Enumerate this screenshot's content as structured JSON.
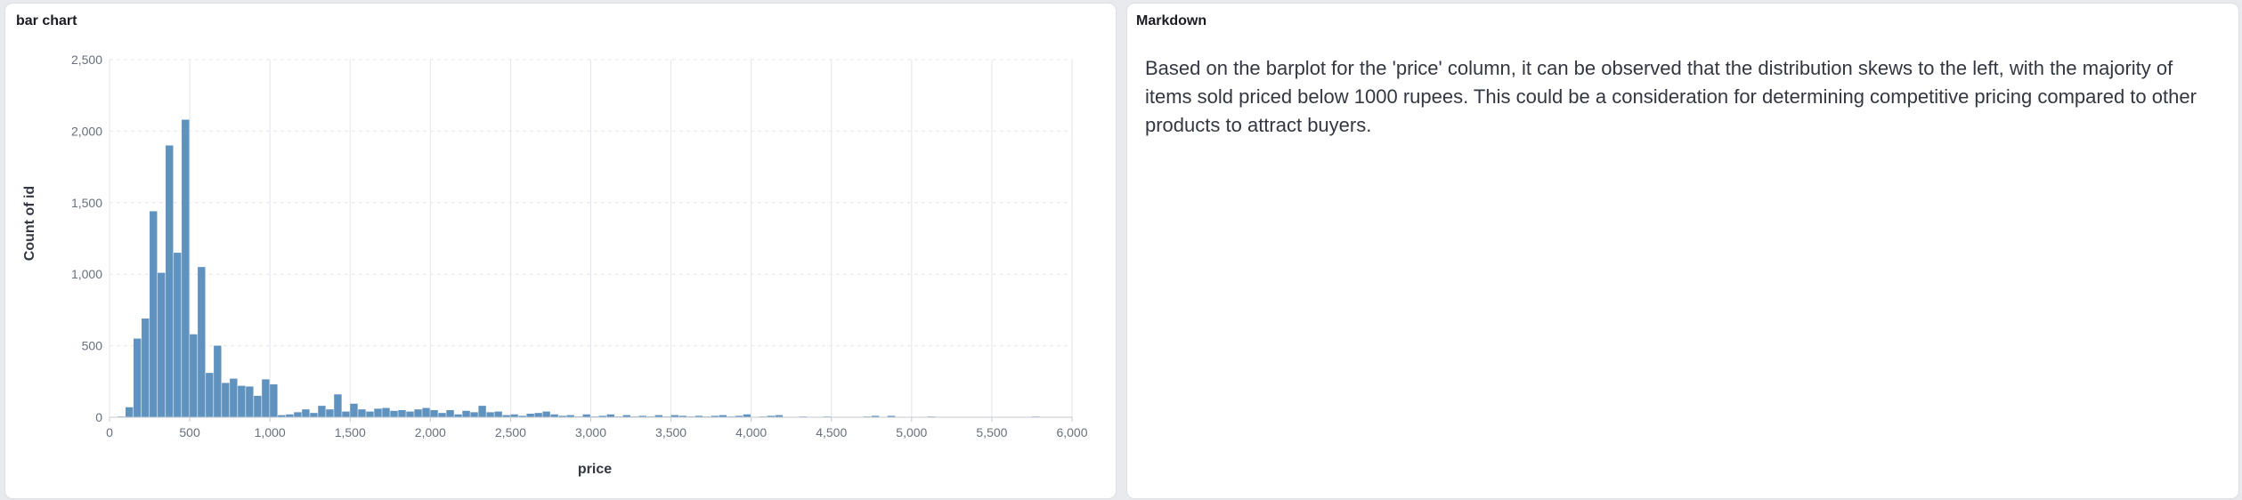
{
  "chart_panel": {
    "title": "bar chart"
  },
  "markdown_panel": {
    "title": "Markdown",
    "text": "Based on the barplot for the 'price' column, it can be observed that the distribution skews to the left, with the majority of items sold priced below 1000 rupees. This could be a consideration for determining competitive pricing compared to other products to attract buyers."
  },
  "colors": {
    "bar": "#6092c0",
    "grid": "#e3e6ea",
    "axis": "#c5c9d1"
  },
  "chart_data": {
    "type": "bar",
    "title": "",
    "xlabel": "price",
    "ylabel": "Count of id",
    "xlim": [
      0,
      6000
    ],
    "ylim": [
      0,
      2500
    ],
    "x_ticks": [
      "0",
      "500",
      "1,000",
      "1,500",
      "2,000",
      "2,500",
      "3,000",
      "3,500",
      "4,000",
      "4,500",
      "5,000",
      "5,500",
      "6,000"
    ],
    "y_ticks": [
      "0",
      "500",
      "1,000",
      "1,500",
      "2,000",
      "2,500"
    ],
    "grid": true,
    "bin_width": 50,
    "bins": [
      {
        "x": 50,
        "count": 5
      },
      {
        "x": 100,
        "count": 70
      },
      {
        "x": 150,
        "count": 550
      },
      {
        "x": 200,
        "count": 690
      },
      {
        "x": 250,
        "count": 1440
      },
      {
        "x": 300,
        "count": 1010
      },
      {
        "x": 350,
        "count": 1900
      },
      {
        "x": 400,
        "count": 1150
      },
      {
        "x": 450,
        "count": 2080
      },
      {
        "x": 500,
        "count": 580
      },
      {
        "x": 550,
        "count": 1050
      },
      {
        "x": 600,
        "count": 310
      },
      {
        "x": 650,
        "count": 500
      },
      {
        "x": 700,
        "count": 240
      },
      {
        "x": 750,
        "count": 270
      },
      {
        "x": 800,
        "count": 220
      },
      {
        "x": 850,
        "count": 215
      },
      {
        "x": 900,
        "count": 150
      },
      {
        "x": 950,
        "count": 265
      },
      {
        "x": 1000,
        "count": 230
      },
      {
        "x": 1050,
        "count": 15
      },
      {
        "x": 1100,
        "count": 20
      },
      {
        "x": 1150,
        "count": 35
      },
      {
        "x": 1200,
        "count": 55
      },
      {
        "x": 1250,
        "count": 30
      },
      {
        "x": 1300,
        "count": 80
      },
      {
        "x": 1350,
        "count": 55
      },
      {
        "x": 1400,
        "count": 160
      },
      {
        "x": 1450,
        "count": 40
      },
      {
        "x": 1500,
        "count": 95
      },
      {
        "x": 1550,
        "count": 55
      },
      {
        "x": 1600,
        "count": 40
      },
      {
        "x": 1650,
        "count": 60
      },
      {
        "x": 1700,
        "count": 65
      },
      {
        "x": 1750,
        "count": 45
      },
      {
        "x": 1800,
        "count": 50
      },
      {
        "x": 1850,
        "count": 40
      },
      {
        "x": 1900,
        "count": 55
      },
      {
        "x": 1950,
        "count": 65
      },
      {
        "x": 2000,
        "count": 50
      },
      {
        "x": 2050,
        "count": 30
      },
      {
        "x": 2100,
        "count": 50
      },
      {
        "x": 2150,
        "count": 20
      },
      {
        "x": 2200,
        "count": 45
      },
      {
        "x": 2250,
        "count": 35
      },
      {
        "x": 2300,
        "count": 80
      },
      {
        "x": 2350,
        "count": 35
      },
      {
        "x": 2400,
        "count": 40
      },
      {
        "x": 2450,
        "count": 15
      },
      {
        "x": 2500,
        "count": 20
      },
      {
        "x": 2550,
        "count": 10
      },
      {
        "x": 2600,
        "count": 25
      },
      {
        "x": 2650,
        "count": 30
      },
      {
        "x": 2700,
        "count": 40
      },
      {
        "x": 2750,
        "count": 20
      },
      {
        "x": 2800,
        "count": 10
      },
      {
        "x": 2850,
        "count": 15
      },
      {
        "x": 2900,
        "count": 5
      },
      {
        "x": 2950,
        "count": 20
      },
      {
        "x": 3000,
        "count": 5
      },
      {
        "x": 3050,
        "count": 10
      },
      {
        "x": 3100,
        "count": 20
      },
      {
        "x": 3150,
        "count": 5
      },
      {
        "x": 3200,
        "count": 15
      },
      {
        "x": 3250,
        "count": 5
      },
      {
        "x": 3300,
        "count": 10
      },
      {
        "x": 3350,
        "count": 5
      },
      {
        "x": 3400,
        "count": 15
      },
      {
        "x": 3450,
        "count": 5
      },
      {
        "x": 3500,
        "count": 15
      },
      {
        "x": 3550,
        "count": 10
      },
      {
        "x": 3600,
        "count": 5
      },
      {
        "x": 3650,
        "count": 10
      },
      {
        "x": 3700,
        "count": 5
      },
      {
        "x": 3750,
        "count": 10
      },
      {
        "x": 3800,
        "count": 15
      },
      {
        "x": 3850,
        "count": 5
      },
      {
        "x": 3900,
        "count": 10
      },
      {
        "x": 3950,
        "count": 20
      },
      {
        "x": 4050,
        "count": 5
      },
      {
        "x": 4100,
        "count": 10
      },
      {
        "x": 4150,
        "count": 15
      },
      {
        "x": 4300,
        "count": 5
      },
      {
        "x": 4450,
        "count": 5
      },
      {
        "x": 4700,
        "count": 5
      },
      {
        "x": 4750,
        "count": 10
      },
      {
        "x": 4850,
        "count": 10
      },
      {
        "x": 5100,
        "count": 5
      },
      {
        "x": 5750,
        "count": 5
      }
    ]
  }
}
